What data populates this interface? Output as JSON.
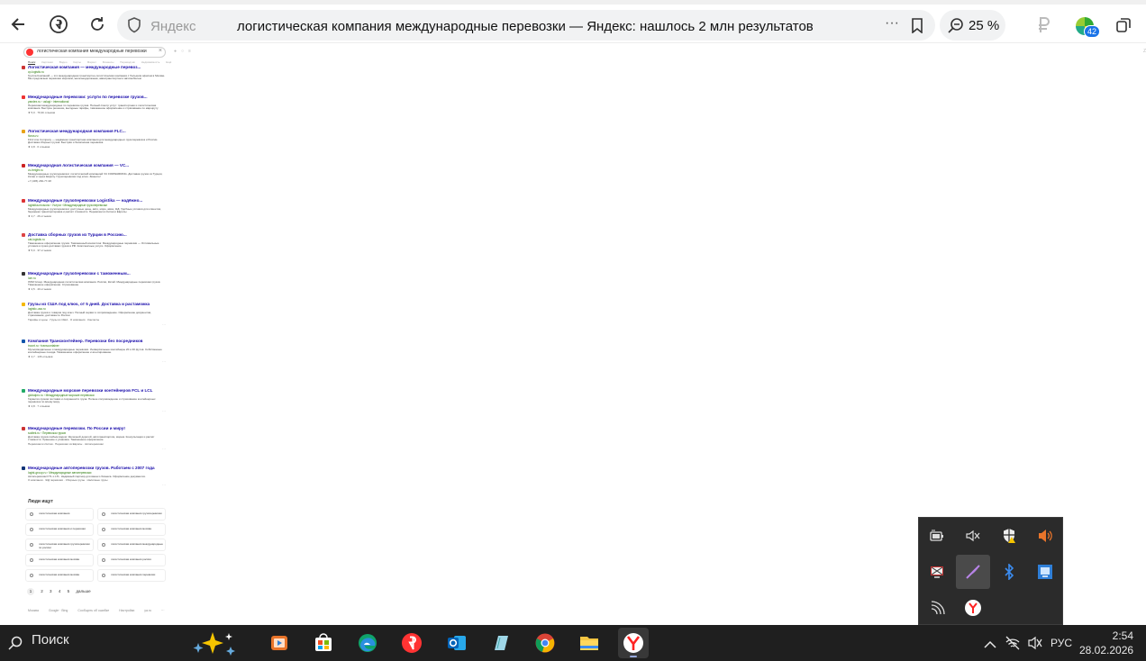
{
  "browser": {
    "address_domain": "Яндекс",
    "page_title": "логистическая компания международные перевозки — Яндекс: нашлось 2 млн результатов",
    "zoom": "25 %",
    "notif_badge": "42"
  },
  "search": {
    "query": "логистическая компания международные перевозки",
    "tabs": [
      "Поиск",
      "Картинки",
      "Видео",
      "Карты",
      "Маркет",
      "Финансы",
      "Переводчик",
      "Недвижимость",
      "Ещё"
    ],
    "results": [
      {
        "title": "Логистическая компания — международные перевоз...",
        "host": "cp-logistic.ru",
        "desc": "Группа Компаний — это международная транспортно-логистическая компания с большим офисом в Москве. Мы предлагаем перевозки морским, железнодорожным, авиатранспортом и автомобилем",
        "meta": "★ 5,0"
      },
      {
        "title": "Международные перевозки: услуги по перевозке грузов...",
        "host": "yandex.ru › uslugi › international",
        "desc": "Перевозки международные по перевозке грузов. Полный спектр услуг: транспортная и логистическая компания. Быстрое решение, выгодные тарифы, таможенное оформление и страхование по маршруту",
        "meta": "★ 5,0 · 79,3К отзывов"
      },
      {
        "title": "Логистическая международная компания FLC...",
        "host": "flcrus.ru",
        "desc": "First Line Company — надёжная транспортная компания для международных грузоперевозок и России. Доставка сборных грузов. Быстрая и безопасная перевозка",
        "meta": "★ 4,8 · 6 отзывов"
      },
      {
        "title": "Международная логистическая компания — VC...",
        "host": "vc-freight.ru",
        "desc": "Международные грузоперевозки: логистический компанией VC FORWARDING. Доставка грузов из Турции, Китая и через Европу. Грузоперевозки под ключ. Звоните!",
        "meta": "+7 (495) 266-77-38"
      },
      {
        "title": "Международные грузоперевозки Logistika — надёжно...",
        "host": "logistika.moscow › Услуги › Международные грузоперевозки",
        "desc": "Международные грузоперевозки: доступные цены, авто, море, авиа, ЖД. Удобные условия для клиентов, бережная транспортировка и расчёт стоимости. Перевозки из Китая и Европы",
        "meta": "★ 4,7 · 26 отзывов"
      },
      {
        "title": "Доставка сборных грузов из Турции в Россию...",
        "host": "cat-logistic.ru",
        "desc": "Таможенное оформление грузов. Таможенный консалтинг. Международные перевозки — Оптимальные условия и сроки доставки грузов в РФ. Комплексные услуги. Оформление",
        "meta": "★ 5,0 · 37 отзывов"
      },
      {
        "title": "Международные грузоперевозки с таможенным...",
        "host": "lom.ru",
        "desc": "ЛОМ Group. Международная логистическая компания. Россия, Китай. Международные перевозки грузов. Таможенное оформление. Страхование.",
        "meta": "★ 4,5 · 40 отзывов"
      },
      {
        "title": "Грузы из США под ключ, от 5 дней. Доставка и растаможка",
        "host": "logistic-usa.ru",
        "desc": "Доставка грузов и товаров под ключ. Полный сервис и сопровождение. Оформление документов, страхование, доставка по России",
        "meta": "Тарифы и цены · Грузы из США · О компании · Контакты"
      },
      {
        "title": "Компания Трансконтейнер. Перевозки без посредников",
        "host": "trcont.ru › transcontainer",
        "desc": "Мультимодальные и международные перевозки. Универсальные контейнеры 20 и 40 футов. Собственные контейнерные поезда. Таможенное оформление и агентирование.",
        "meta": "★ 4,7 · 136 отзывов"
      },
      {
        "title": "Международные морские перевозки контейнеров FCL и LCL",
        "host": "globalpro.ru › Международные морские перевозки",
        "desc": "Гарантия сроков поставки и сохранности груза. Полное сопровождение и страхование контейнерных перевозок по всему миру.",
        "meta": "★ 4,8 · 7 отзывов"
      },
      {
        "title": "Международные перевозки. По России и миру!",
        "host": "sodtek.ru › Перевозка грузов",
        "desc": "Доставка грузов любым видом: Железной дорогой, автотранспортом, морем. Консультация и расчёт стоимости. Хранение и упаковка. Таможенное оформление.",
        "meta": "Перевозки из Китая · Перевозки из Европы · Автоперевозки"
      },
      {
        "title": "Международные автоперевозки грузов. Работаем с 2007 года",
        "host": "logist-group.ru › Международные автоперевозки",
        "desc": "Автоперевозки FTL и LTL. Надёжный партнёр для вашего бизнеса. Оформление документов.",
        "meta": "О компании · ЖД перевозки · Сборные грузы · Наличные грузы"
      }
    ],
    "people_also_search_label": "Люди ищут",
    "related": [
      "логистическая компания",
      "логистическая компания грузоперевозки",
      "логистическая компания и перевозки",
      "логистическая компания москва",
      "логистическая компания грузоперевозки по россии",
      "логистическая компания международные",
      "логистическая компания москва",
      "логистическая компания россия",
      "логистическая компания москва",
      "логистическая компания перевозки"
    ],
    "pages": [
      "1",
      "2",
      "3",
      "4",
      "5",
      "дальше"
    ],
    "footer": [
      "Москва",
      "Google · Bing",
      "Сообщить об ошибке",
      "Настройки",
      "ya.ru",
      "···"
    ]
  },
  "taskbar": {
    "search_label": "Поиск",
    "language": "РУС",
    "time": "2:54",
    "date": "28.02.2026"
  }
}
